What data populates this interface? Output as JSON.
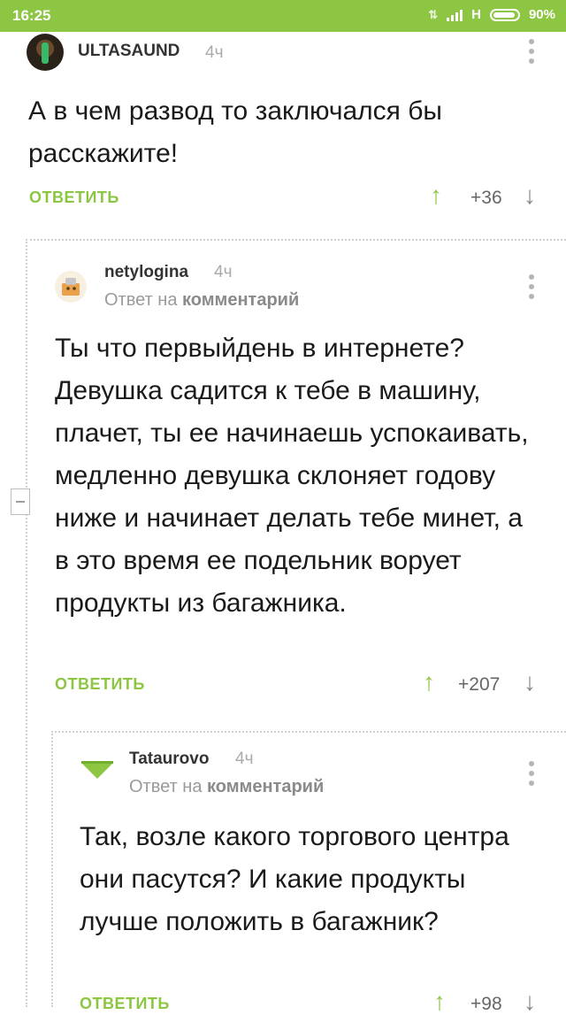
{
  "status_bar": {
    "time": "16:25",
    "network": "H",
    "battery": "90%"
  },
  "comments": [
    {
      "author": "ULTASAUND",
      "time": "4ч",
      "body": "А в чем развод то заключался бы расскажите!",
      "reply_label": "ОТВЕТИТЬ",
      "score": "+36"
    },
    {
      "author": "netylogina",
      "time": "4ч",
      "reply_prefix": "Ответ на",
      "reply_target": "комментарий",
      "body": "Ты что первыйдень в интернете? Девушка садится к тебе в машину, плачет, ты ее начинаешь успокаивать, медленно девушка склоняет годову ниже и начинает делать тебе минет, а в это время ее подельник ворует продукты из багажника.",
      "reply_label": "ОТВЕТИТЬ",
      "score": "+207"
    },
    {
      "author": "Tataurovo",
      "time": "4ч",
      "reply_prefix": "Ответ на",
      "reply_target": "комментарий",
      "body": "Так, возле какого торгового центра они пасутся? И какие продукты лучше положить в багажник?",
      "reply_label": "ОТВЕТИТЬ",
      "score": "+98"
    }
  ],
  "icons": {
    "upvote": "arrow-up-icon",
    "downvote": "arrow-down-icon",
    "menu": "more-vertical-icon",
    "collapse": "collapse-thread-icon"
  },
  "colors": {
    "accent": "#8dc642",
    "status_bar": "#8dc642"
  }
}
